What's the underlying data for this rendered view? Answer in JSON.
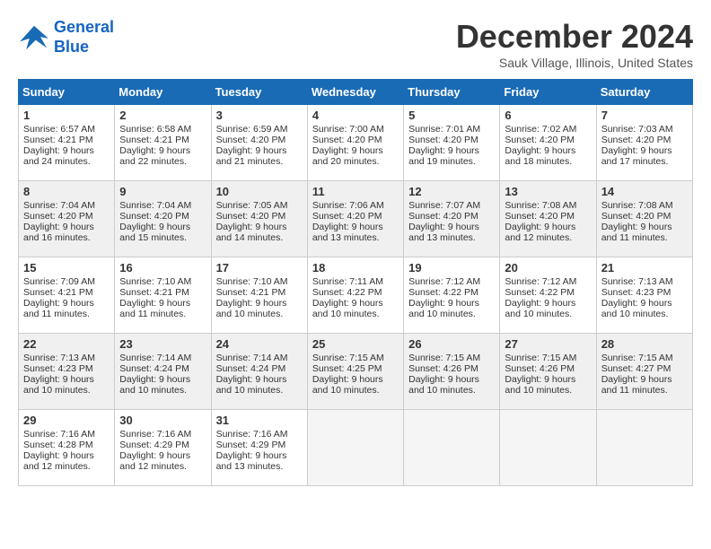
{
  "header": {
    "logo_line1": "General",
    "logo_line2": "Blue",
    "month": "December 2024",
    "location": "Sauk Village, Illinois, United States"
  },
  "weekdays": [
    "Sunday",
    "Monday",
    "Tuesday",
    "Wednesday",
    "Thursday",
    "Friday",
    "Saturday"
  ],
  "weeks": [
    [
      {
        "day": "1",
        "sunrise": "Sunrise: 6:57 AM",
        "sunset": "Sunset: 4:21 PM",
        "daylight": "Daylight: 9 hours and 24 minutes."
      },
      {
        "day": "2",
        "sunrise": "Sunrise: 6:58 AM",
        "sunset": "Sunset: 4:21 PM",
        "daylight": "Daylight: 9 hours and 22 minutes."
      },
      {
        "day": "3",
        "sunrise": "Sunrise: 6:59 AM",
        "sunset": "Sunset: 4:20 PM",
        "daylight": "Daylight: 9 hours and 21 minutes."
      },
      {
        "day": "4",
        "sunrise": "Sunrise: 7:00 AM",
        "sunset": "Sunset: 4:20 PM",
        "daylight": "Daylight: 9 hours and 20 minutes."
      },
      {
        "day": "5",
        "sunrise": "Sunrise: 7:01 AM",
        "sunset": "Sunset: 4:20 PM",
        "daylight": "Daylight: 9 hours and 19 minutes."
      },
      {
        "day": "6",
        "sunrise": "Sunrise: 7:02 AM",
        "sunset": "Sunset: 4:20 PM",
        "daylight": "Daylight: 9 hours and 18 minutes."
      },
      {
        "day": "7",
        "sunrise": "Sunrise: 7:03 AM",
        "sunset": "Sunset: 4:20 PM",
        "daylight": "Daylight: 9 hours and 17 minutes."
      }
    ],
    [
      {
        "day": "8",
        "sunrise": "Sunrise: 7:04 AM",
        "sunset": "Sunset: 4:20 PM",
        "daylight": "Daylight: 9 hours and 16 minutes."
      },
      {
        "day": "9",
        "sunrise": "Sunrise: 7:04 AM",
        "sunset": "Sunset: 4:20 PM",
        "daylight": "Daylight: 9 hours and 15 minutes."
      },
      {
        "day": "10",
        "sunrise": "Sunrise: 7:05 AM",
        "sunset": "Sunset: 4:20 PM",
        "daylight": "Daylight: 9 hours and 14 minutes."
      },
      {
        "day": "11",
        "sunrise": "Sunrise: 7:06 AM",
        "sunset": "Sunset: 4:20 PM",
        "daylight": "Daylight: 9 hours and 13 minutes."
      },
      {
        "day": "12",
        "sunrise": "Sunrise: 7:07 AM",
        "sunset": "Sunset: 4:20 PM",
        "daylight": "Daylight: 9 hours and 13 minutes."
      },
      {
        "day": "13",
        "sunrise": "Sunrise: 7:08 AM",
        "sunset": "Sunset: 4:20 PM",
        "daylight": "Daylight: 9 hours and 12 minutes."
      },
      {
        "day": "14",
        "sunrise": "Sunrise: 7:08 AM",
        "sunset": "Sunset: 4:20 PM",
        "daylight": "Daylight: 9 hours and 11 minutes."
      }
    ],
    [
      {
        "day": "15",
        "sunrise": "Sunrise: 7:09 AM",
        "sunset": "Sunset: 4:21 PM",
        "daylight": "Daylight: 9 hours and 11 minutes."
      },
      {
        "day": "16",
        "sunrise": "Sunrise: 7:10 AM",
        "sunset": "Sunset: 4:21 PM",
        "daylight": "Daylight: 9 hours and 11 minutes."
      },
      {
        "day": "17",
        "sunrise": "Sunrise: 7:10 AM",
        "sunset": "Sunset: 4:21 PM",
        "daylight": "Daylight: 9 hours and 10 minutes."
      },
      {
        "day": "18",
        "sunrise": "Sunrise: 7:11 AM",
        "sunset": "Sunset: 4:22 PM",
        "daylight": "Daylight: 9 hours and 10 minutes."
      },
      {
        "day": "19",
        "sunrise": "Sunrise: 7:12 AM",
        "sunset": "Sunset: 4:22 PM",
        "daylight": "Daylight: 9 hours and 10 minutes."
      },
      {
        "day": "20",
        "sunrise": "Sunrise: 7:12 AM",
        "sunset": "Sunset: 4:22 PM",
        "daylight": "Daylight: 9 hours and 10 minutes."
      },
      {
        "day": "21",
        "sunrise": "Sunrise: 7:13 AM",
        "sunset": "Sunset: 4:23 PM",
        "daylight": "Daylight: 9 hours and 10 minutes."
      }
    ],
    [
      {
        "day": "22",
        "sunrise": "Sunrise: 7:13 AM",
        "sunset": "Sunset: 4:23 PM",
        "daylight": "Daylight: 9 hours and 10 minutes."
      },
      {
        "day": "23",
        "sunrise": "Sunrise: 7:14 AM",
        "sunset": "Sunset: 4:24 PM",
        "daylight": "Daylight: 9 hours and 10 minutes."
      },
      {
        "day": "24",
        "sunrise": "Sunrise: 7:14 AM",
        "sunset": "Sunset: 4:24 PM",
        "daylight": "Daylight: 9 hours and 10 minutes."
      },
      {
        "day": "25",
        "sunrise": "Sunrise: 7:15 AM",
        "sunset": "Sunset: 4:25 PM",
        "daylight": "Daylight: 9 hours and 10 minutes."
      },
      {
        "day": "26",
        "sunrise": "Sunrise: 7:15 AM",
        "sunset": "Sunset: 4:26 PM",
        "daylight": "Daylight: 9 hours and 10 minutes."
      },
      {
        "day": "27",
        "sunrise": "Sunrise: 7:15 AM",
        "sunset": "Sunset: 4:26 PM",
        "daylight": "Daylight: 9 hours and 10 minutes."
      },
      {
        "day": "28",
        "sunrise": "Sunrise: 7:15 AM",
        "sunset": "Sunset: 4:27 PM",
        "daylight": "Daylight: 9 hours and 11 minutes."
      }
    ],
    [
      {
        "day": "29",
        "sunrise": "Sunrise: 7:16 AM",
        "sunset": "Sunset: 4:28 PM",
        "daylight": "Daylight: 9 hours and 12 minutes."
      },
      {
        "day": "30",
        "sunrise": "Sunrise: 7:16 AM",
        "sunset": "Sunset: 4:29 PM",
        "daylight": "Daylight: 9 hours and 12 minutes."
      },
      {
        "day": "31",
        "sunrise": "Sunrise: 7:16 AM",
        "sunset": "Sunset: 4:29 PM",
        "daylight": "Daylight: 9 hours and 13 minutes."
      },
      null,
      null,
      null,
      null
    ]
  ]
}
